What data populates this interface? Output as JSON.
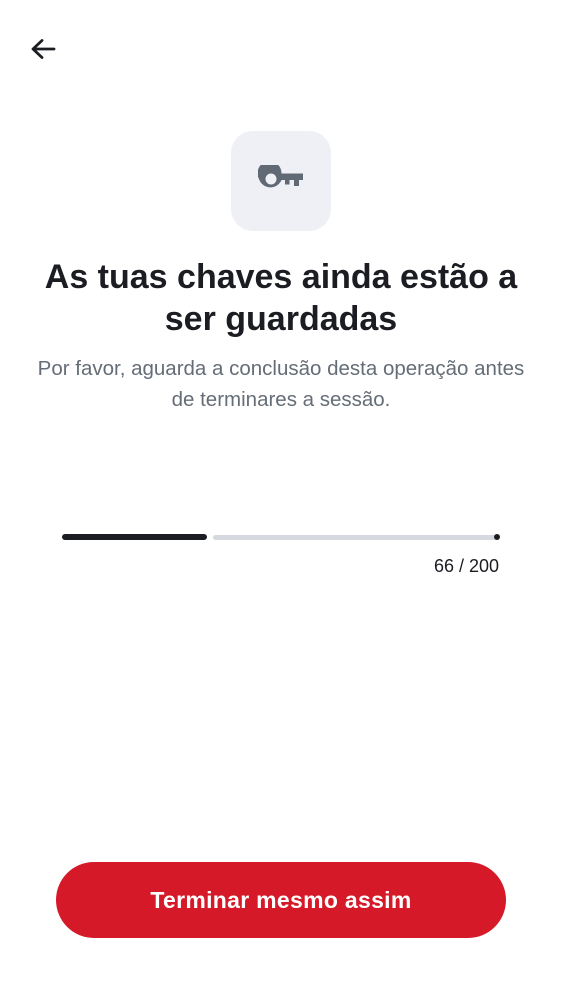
{
  "header": {
    "back_icon": "arrow-left-icon"
  },
  "hero": {
    "icon": "key-icon",
    "title": "As tuas chaves ainda estão a ser guardadas",
    "description": "Por favor, aguarda a conclusão desta operação antes de terminares a sessão."
  },
  "progress": {
    "current": 66,
    "total": 200,
    "label": "66 / 200"
  },
  "footer": {
    "button_label": "Terminar mesmo assim"
  },
  "colors": {
    "accent": "#d51928",
    "text_primary": "#1b1d22",
    "text_secondary": "#656d77",
    "icon_tile_bg": "#eff0f5",
    "track": "#d5d9df"
  }
}
